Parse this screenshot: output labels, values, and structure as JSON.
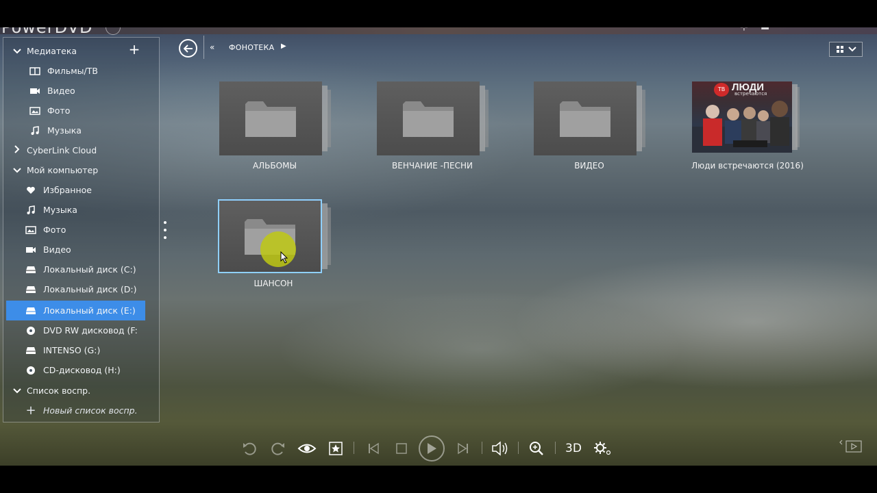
{
  "app": {
    "brand": "PowerDVD"
  },
  "sidebar": {
    "library": {
      "label": "Медиатека",
      "items": [
        {
          "label": "Фильмы/ТВ",
          "icon": "film-tv-icon"
        },
        {
          "label": "Видео",
          "icon": "video-camera-icon"
        },
        {
          "label": "Фото",
          "icon": "photo-icon"
        },
        {
          "label": "Музыка",
          "icon": "music-note-icon"
        }
      ]
    },
    "cloud": {
      "label": "CyberLink Cloud"
    },
    "computer": {
      "label": "Мой компьютер",
      "items": [
        {
          "label": "Избранное",
          "icon": "heart-icon"
        },
        {
          "label": "Музыка",
          "icon": "music-note-icon"
        },
        {
          "label": "Фото",
          "icon": "photo-icon"
        },
        {
          "label": "Видео",
          "icon": "video-camera-icon"
        },
        {
          "label": "Локальный диск (C:)",
          "icon": "drive-icon"
        },
        {
          "label": "Локальный диск (D:)",
          "icon": "drive-icon"
        },
        {
          "label": "Локальный диск (E:)",
          "icon": "drive-icon",
          "selected": true
        },
        {
          "label": "DVD RW дисковод (F:",
          "icon": "disc-icon"
        },
        {
          "label": "INTENSO (G:)",
          "icon": "drive-icon"
        },
        {
          "label": "CD-дисковод (H:)",
          "icon": "disc-icon"
        }
      ]
    },
    "playlists": {
      "label": "Список воспр.",
      "new_label": "Новый список воспр."
    }
  },
  "header": {
    "breadcrumb": "ФОНОТЕКА"
  },
  "grid": {
    "items": [
      {
        "label": "АЛЬБОМЫ",
        "type": "folder"
      },
      {
        "label": "ВЕНЧАНИЕ -ПЕСНИ",
        "type": "folder"
      },
      {
        "label": "ВИДЕО",
        "type": "folder"
      },
      {
        "label": "Люди встречаются (2016)",
        "type": "album"
      },
      {
        "label": "ШАНСОН",
        "type": "folder",
        "focused": true
      }
    ],
    "album_art": {
      "logo": "ТВ",
      "title": "ЛЮДИ",
      "subtitle": "встречаются"
    }
  },
  "toolbar": {
    "threed_label": "3D"
  },
  "colors": {
    "selection": "#3d8de8",
    "focus_border": "#8fd0ff",
    "cursor_highlight": "#bec814"
  }
}
